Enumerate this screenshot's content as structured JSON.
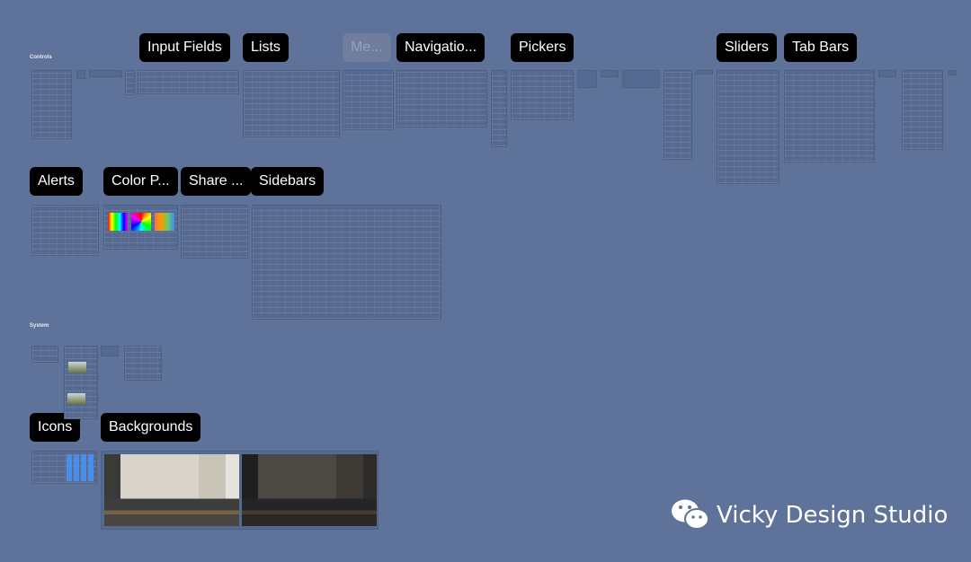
{
  "sections": {
    "controls": "Controls",
    "system": "System"
  },
  "labels": {
    "input_fields": "Input Fields",
    "lists": "Lists",
    "menus": "Me...",
    "navigation": "Navigatio...",
    "pickers": "Pickers",
    "sliders": "Sliders",
    "tab_bars": "Tab Bars",
    "alerts": "Alerts",
    "color_pickers": "Color P...",
    "share": "Share ...",
    "sidebars": "Sidebars",
    "icons": "Icons",
    "backgrounds": "Backgrounds"
  },
  "watermark": {
    "text": "Vicky Design Studio",
    "icon": "wechat-icon"
  },
  "colors": {
    "canvas": "#5f7299",
    "label_bg": "#000000",
    "frame": "#566a91"
  }
}
